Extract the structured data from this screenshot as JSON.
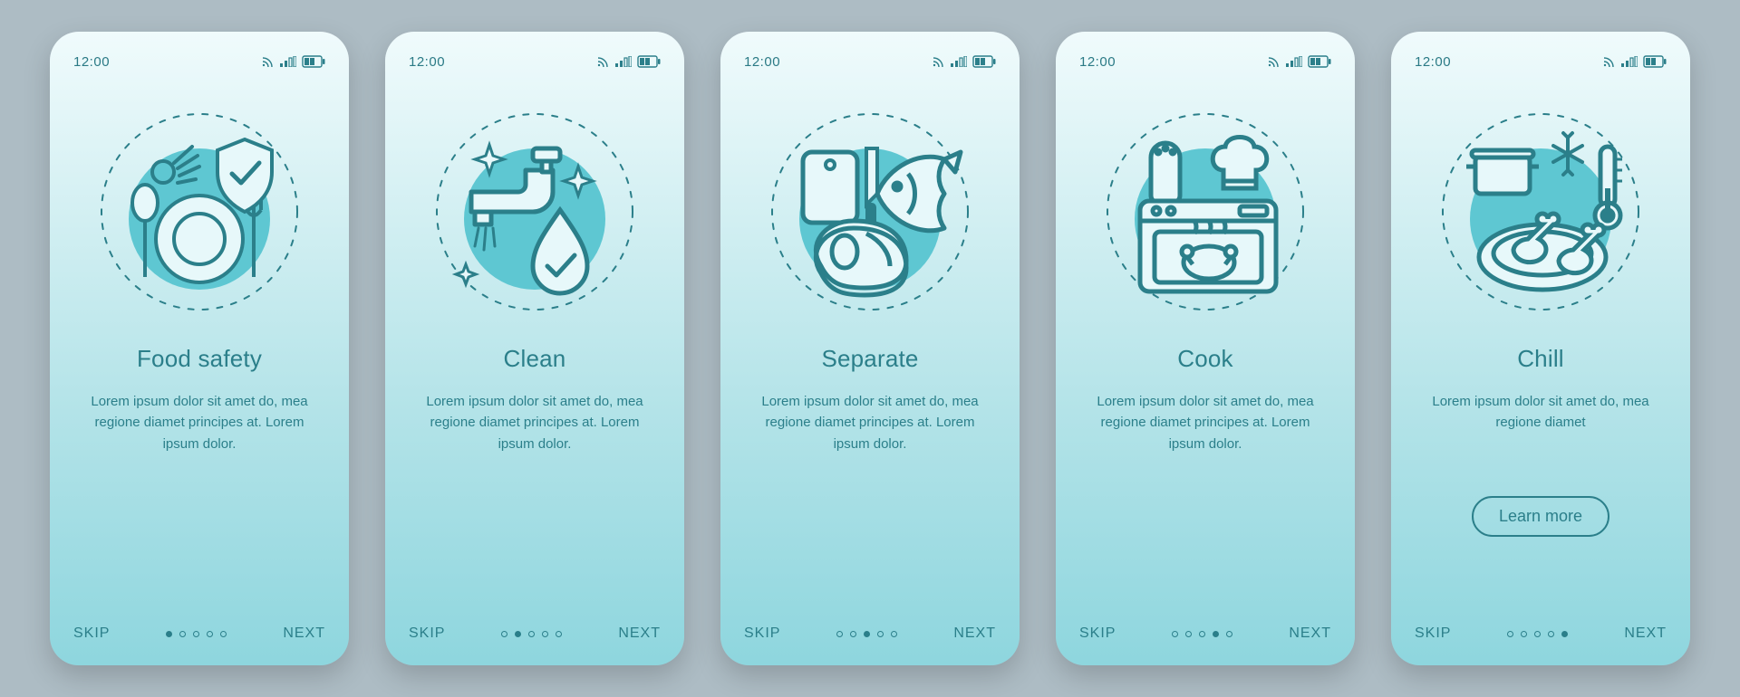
{
  "status_bar": {
    "time": "12:00"
  },
  "nav": {
    "skip": "SKIP",
    "next": "NEXT",
    "total_pages": 5
  },
  "learn_more_label": "Learn more",
  "screens": [
    {
      "id": "food-safety",
      "title": "Food safety",
      "body": "Lorem ipsum dolor sit amet do, mea regione diamet principes at. Lorem ipsum dolor.",
      "active_index": 0,
      "has_learn_more": false,
      "icon": "food-safety-icon"
    },
    {
      "id": "clean",
      "title": "Clean",
      "body": "Lorem ipsum dolor sit amet do, mea regione diamet principes at. Lorem ipsum dolor.",
      "active_index": 1,
      "has_learn_more": false,
      "icon": "clean-icon"
    },
    {
      "id": "separate",
      "title": "Separate",
      "body": "Lorem ipsum dolor sit amet do, mea regione diamet principes at. Lorem ipsum dolor.",
      "active_index": 2,
      "has_learn_more": false,
      "icon": "separate-icon"
    },
    {
      "id": "cook",
      "title": "Cook",
      "body": "Lorem ipsum dolor sit amet do, mea regione diamet principes at. Lorem ipsum dolor.",
      "active_index": 3,
      "has_learn_more": false,
      "icon": "cook-icon"
    },
    {
      "id": "chill",
      "title": "Chill",
      "body": "Lorem ipsum dolor sit amet do, mea regione diamet",
      "active_index": 4,
      "has_learn_more": true,
      "icon": "chill-icon"
    }
  ],
  "colors": {
    "stroke": "#2b7f8a",
    "accent_fill": "#5ec7d2",
    "bg_light": "#e7f8fa"
  }
}
